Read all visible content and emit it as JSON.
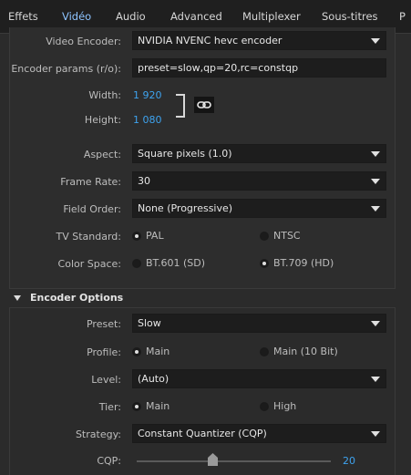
{
  "tabs": [
    {
      "label": "Effets"
    },
    {
      "label": "Vidéo"
    },
    {
      "label": "Audio"
    },
    {
      "label": "Advanced"
    },
    {
      "label": "Multiplexer"
    },
    {
      "label": "Sous-titres"
    },
    {
      "label": "P"
    }
  ],
  "video": {
    "encoder_label": "Video Encoder:",
    "encoder_value": "NVIDIA NVENC hevc encoder",
    "params_label": "Encoder params (r/o):",
    "params_value": "preset=slow,qp=20,rc=constqp",
    "width_label": "Width:",
    "width_value": "1 920",
    "height_label": "Height:",
    "height_value": "1 080",
    "aspect_label": "Aspect:",
    "aspect_value": "Square pixels (1.0)",
    "framerate_label": "Frame Rate:",
    "framerate_value": "30",
    "fieldorder_label": "Field Order:",
    "fieldorder_value": "None (Progressive)",
    "tvstandard_label": "TV Standard:",
    "tvstandard_options": [
      "PAL",
      "NTSC"
    ],
    "colorspace_label": "Color Space:",
    "colorspace_options": [
      "BT.601 (SD)",
      "BT.709 (HD)"
    ]
  },
  "encoder_options": {
    "header": "Encoder Options",
    "preset_label": "Preset:",
    "preset_value": "Slow",
    "profile_label": "Profile:",
    "profile_options": [
      "Main",
      "Main (10 Bit)"
    ],
    "level_label": "Level:",
    "level_value": "(Auto)",
    "tier_label": "Tier:",
    "tier_options": [
      "Main",
      "High"
    ],
    "strategy_label": "Strategy:",
    "strategy_value": "Constant Quantizer (CQP)",
    "cqp_label": "CQP:",
    "cqp_value": "20"
  },
  "colors": {
    "accent": "#2f8fe6",
    "active_tab_text": "#8ec4ff",
    "value_blue": "#3ea3ef",
    "background": "#2b2b2b",
    "field_bg": "#1d1d1d"
  },
  "icons": {
    "link": "link-icon",
    "caret": "chevron-down-icon",
    "section_toggle": "triangle-down-icon"
  }
}
